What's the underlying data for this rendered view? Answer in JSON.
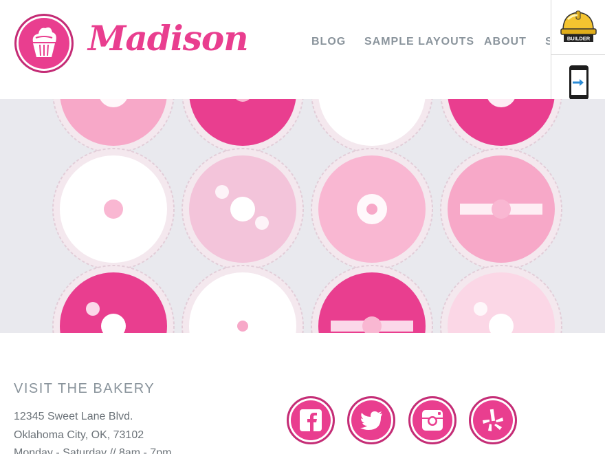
{
  "site": {
    "brand_name": "Madison",
    "logo_icon": "cupcake-icon",
    "accent_color": "#e93e8f"
  },
  "nav": {
    "items": [
      {
        "label": "BLOG"
      },
      {
        "label": "SAMPLE LAYOUTS"
      },
      {
        "label": "ABOUT"
      },
      {
        "label": "S"
      }
    ]
  },
  "tools": {
    "builder_icon": "builder-hardhat-icon",
    "builder_badge": "BUILDER",
    "mobile_icon": "mobile-preview-icon"
  },
  "hero": {
    "image": "pink-cupcakes-hero"
  },
  "visit": {
    "heading": "VISIT THE BAKERY",
    "address_line1": "12345 Sweet Lane Blvd.",
    "address_line2": "Oklahoma City, OK, 73102",
    "hours": "Monday - Saturday // 8am - 7pm"
  },
  "social": [
    {
      "icon": "facebook-icon"
    },
    {
      "icon": "twitter-icon"
    },
    {
      "icon": "instagram-icon"
    },
    {
      "icon": "yelp-icon"
    }
  ]
}
